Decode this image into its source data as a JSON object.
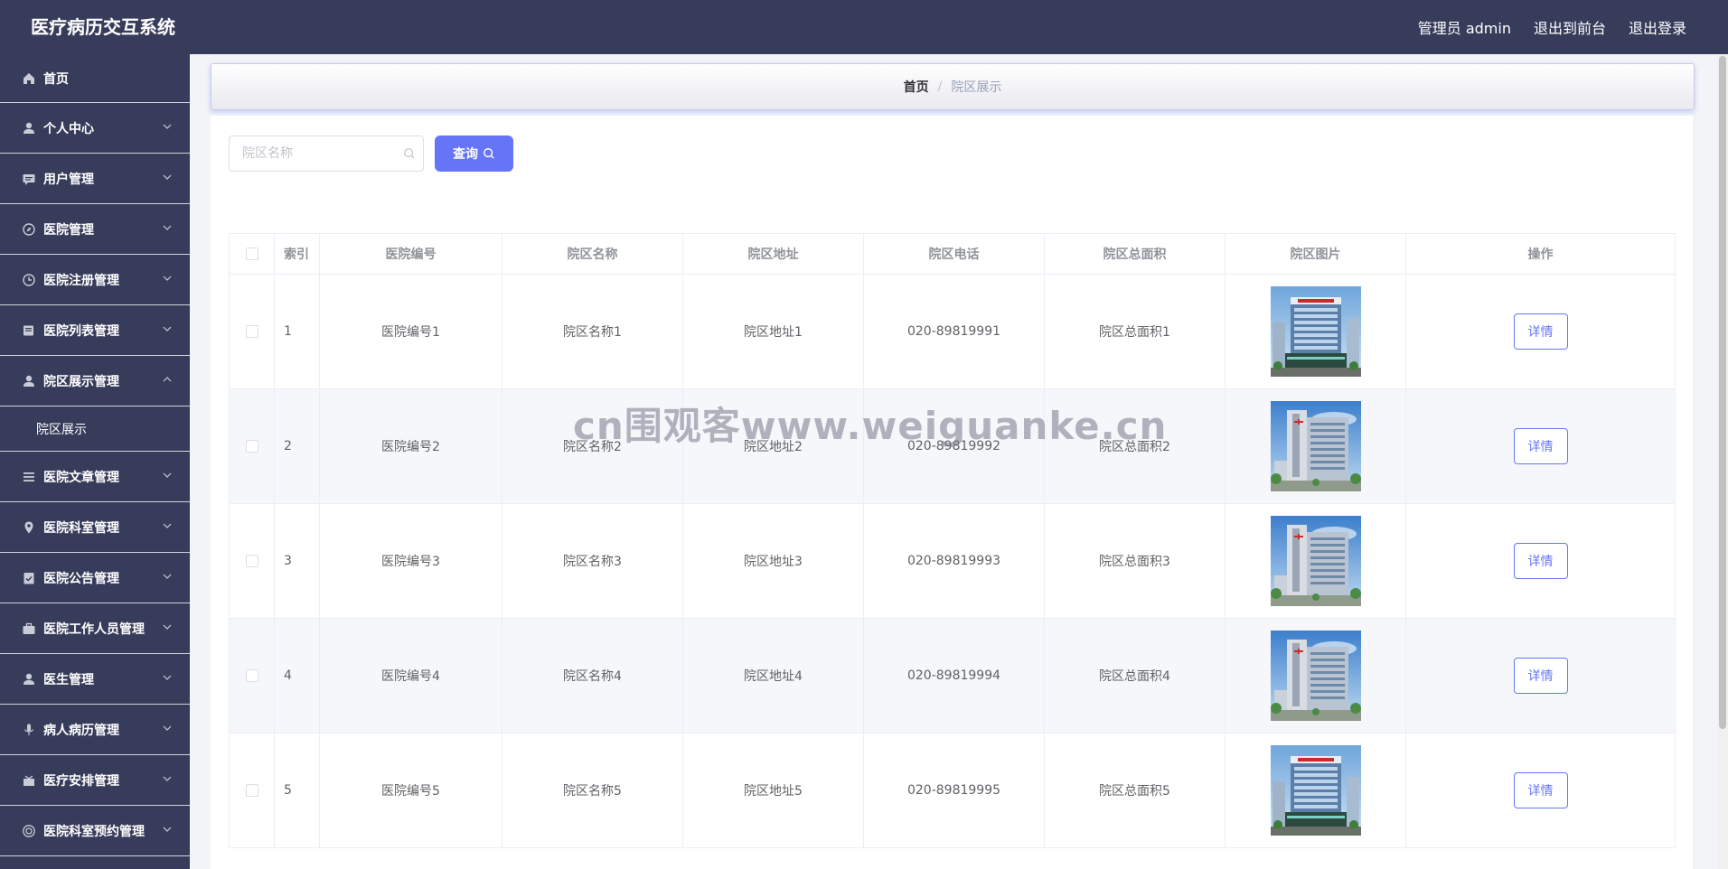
{
  "header": {
    "app_title": "医疗病历交互系统",
    "admin_label": "管理员 admin",
    "to_front_label": "退出到前台",
    "logout_label": "退出登录"
  },
  "sidebar": {
    "items": [
      {
        "label": "首页",
        "icon": "home-icon",
        "expandable": false
      },
      {
        "label": "个人中心",
        "icon": "user-icon",
        "expandable": true
      },
      {
        "label": "用户管理",
        "icon": "message-icon",
        "expandable": true
      },
      {
        "label": "医院管理",
        "icon": "compass-icon",
        "expandable": true
      },
      {
        "label": "医院注册管理",
        "icon": "clock-icon",
        "expandable": true
      },
      {
        "label": "医院列表管理",
        "icon": "folder-icon",
        "expandable": true
      },
      {
        "label": "院区展示管理",
        "icon": "user-icon",
        "expandable": true,
        "expanded": true,
        "children": [
          {
            "label": "院区展示"
          }
        ]
      },
      {
        "label": "医院文章管理",
        "icon": "list-icon",
        "expandable": true
      },
      {
        "label": "医院科室管理",
        "icon": "location-icon",
        "expandable": true
      },
      {
        "label": "医院公告管理",
        "icon": "checked-doc-icon",
        "expandable": true
      },
      {
        "label": "医院工作人员管理",
        "icon": "briefcase-icon",
        "expandable": true
      },
      {
        "label": "医生管理",
        "icon": "user-icon",
        "expandable": true
      },
      {
        "label": "病人病历管理",
        "icon": "microphone-icon",
        "expandable": true
      },
      {
        "label": "医疗安排管理",
        "icon": "finished-icon",
        "expandable": true
      },
      {
        "label": "医院科室预约管理",
        "icon": "film-icon",
        "expandable": true
      }
    ]
  },
  "breadcrumb": {
    "home": "首页",
    "separator": "/",
    "current": "院区展示"
  },
  "search": {
    "placeholder": "院区名称",
    "button_label": "查询"
  },
  "table": {
    "columns": [
      "索引",
      "医院编号",
      "院区名称",
      "院区地址",
      "院区电话",
      "院区总面积",
      "院区图片",
      "操作"
    ],
    "action_label": "详情",
    "rows": [
      {
        "index": "1",
        "hospital_no": "医院编号1",
        "campus_name": "院区名称1",
        "address": "院区地址1",
        "phone": "020-89819991",
        "area": "院区总面积1",
        "image": "building-a"
      },
      {
        "index": "2",
        "hospital_no": "医院编号2",
        "campus_name": "院区名称2",
        "address": "院区地址2",
        "phone": "020-89819992",
        "area": "院区总面积2",
        "image": "building-b"
      },
      {
        "index": "3",
        "hospital_no": "医院编号3",
        "campus_name": "院区名称3",
        "address": "院区地址3",
        "phone": "020-89819993",
        "area": "院区总面积3",
        "image": "building-b"
      },
      {
        "index": "4",
        "hospital_no": "医院编号4",
        "campus_name": "院区名称4",
        "address": "院区地址4",
        "phone": "020-89819994",
        "area": "院区总面积4",
        "image": "building-b"
      },
      {
        "index": "5",
        "hospital_no": "医院编号5",
        "campus_name": "院区名称5",
        "address": "院区地址5",
        "phone": "020-89819995",
        "area": "院区总面积5",
        "image": "building-a"
      }
    ]
  },
  "watermark": "cn围观客www.weiguanke.cn",
  "colors": {
    "header_bg": "#373c5b",
    "sidebar_bg": "#373c5b",
    "accent": "#6674f8"
  }
}
